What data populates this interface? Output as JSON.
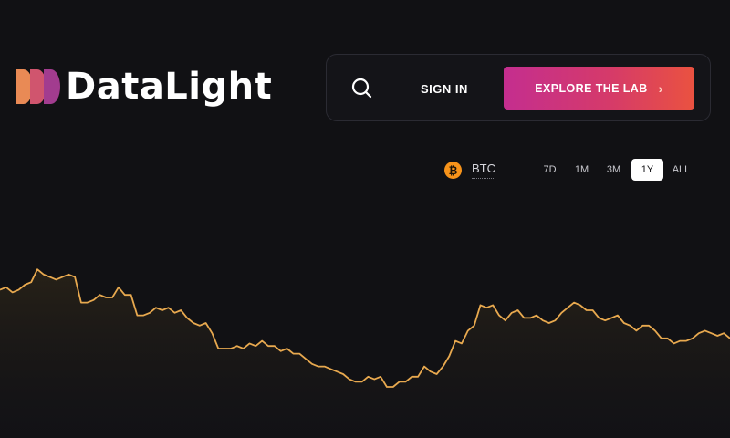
{
  "brand": {
    "name": "DataLight",
    "logo_colors": [
      "#e98a55",
      "#d0556e",
      "#a23c8f"
    ]
  },
  "topbar": {
    "search_icon": "search-icon",
    "sign_in_label": "SIGN IN",
    "explore_label": "EXPLORE THE LAB",
    "explore_icon": "chevron-right-icon"
  },
  "asset": {
    "icon": "bitcoin-icon",
    "symbol_glyph": "₿",
    "label": "BTC"
  },
  "ranges": {
    "items": [
      "7D",
      "1M",
      "3M",
      "1Y",
      "ALL"
    ],
    "selected": "1Y"
  },
  "colors": {
    "background": "#111114",
    "accent_gradient": [
      "#c42e8f",
      "#ea5240"
    ],
    "line": "#e8a94f"
  },
  "chart_data": {
    "type": "area",
    "series": [
      {
        "values": [
          58,
          59,
          57,
          58,
          60,
          61,
          66,
          64,
          63,
          62,
          63,
          64,
          63,
          53,
          53,
          54,
          56,
          55,
          55,
          59,
          56,
          56,
          48,
          48,
          49,
          51,
          50,
          51,
          49,
          50,
          47,
          45,
          44,
          45,
          41,
          35,
          35,
          35,
          36,
          35,
          37,
          36,
          38,
          36,
          36,
          34,
          35,
          33,
          33,
          31,
          29,
          28,
          28,
          27,
          26,
          25,
          23,
          22,
          22,
          24,
          23,
          24,
          20,
          20,
          22,
          22,
          24,
          24,
          28,
          26,
          25,
          28,
          32,
          38,
          37,
          42,
          44,
          52,
          51,
          52,
          48,
          46,
          49,
          50,
          47,
          47,
          48,
          46,
          45,
          46,
          49,
          51,
          53,
          52,
          50,
          50,
          47,
          46,
          47,
          48,
          45,
          44,
          42,
          44,
          44,
          42,
          39,
          39,
          37,
          38,
          38,
          39,
          41,
          42,
          41,
          40,
          41,
          39
        ]
      }
    ],
    "ylim": [
      0,
      100
    ],
    "grid": false,
    "legend": "none"
  }
}
